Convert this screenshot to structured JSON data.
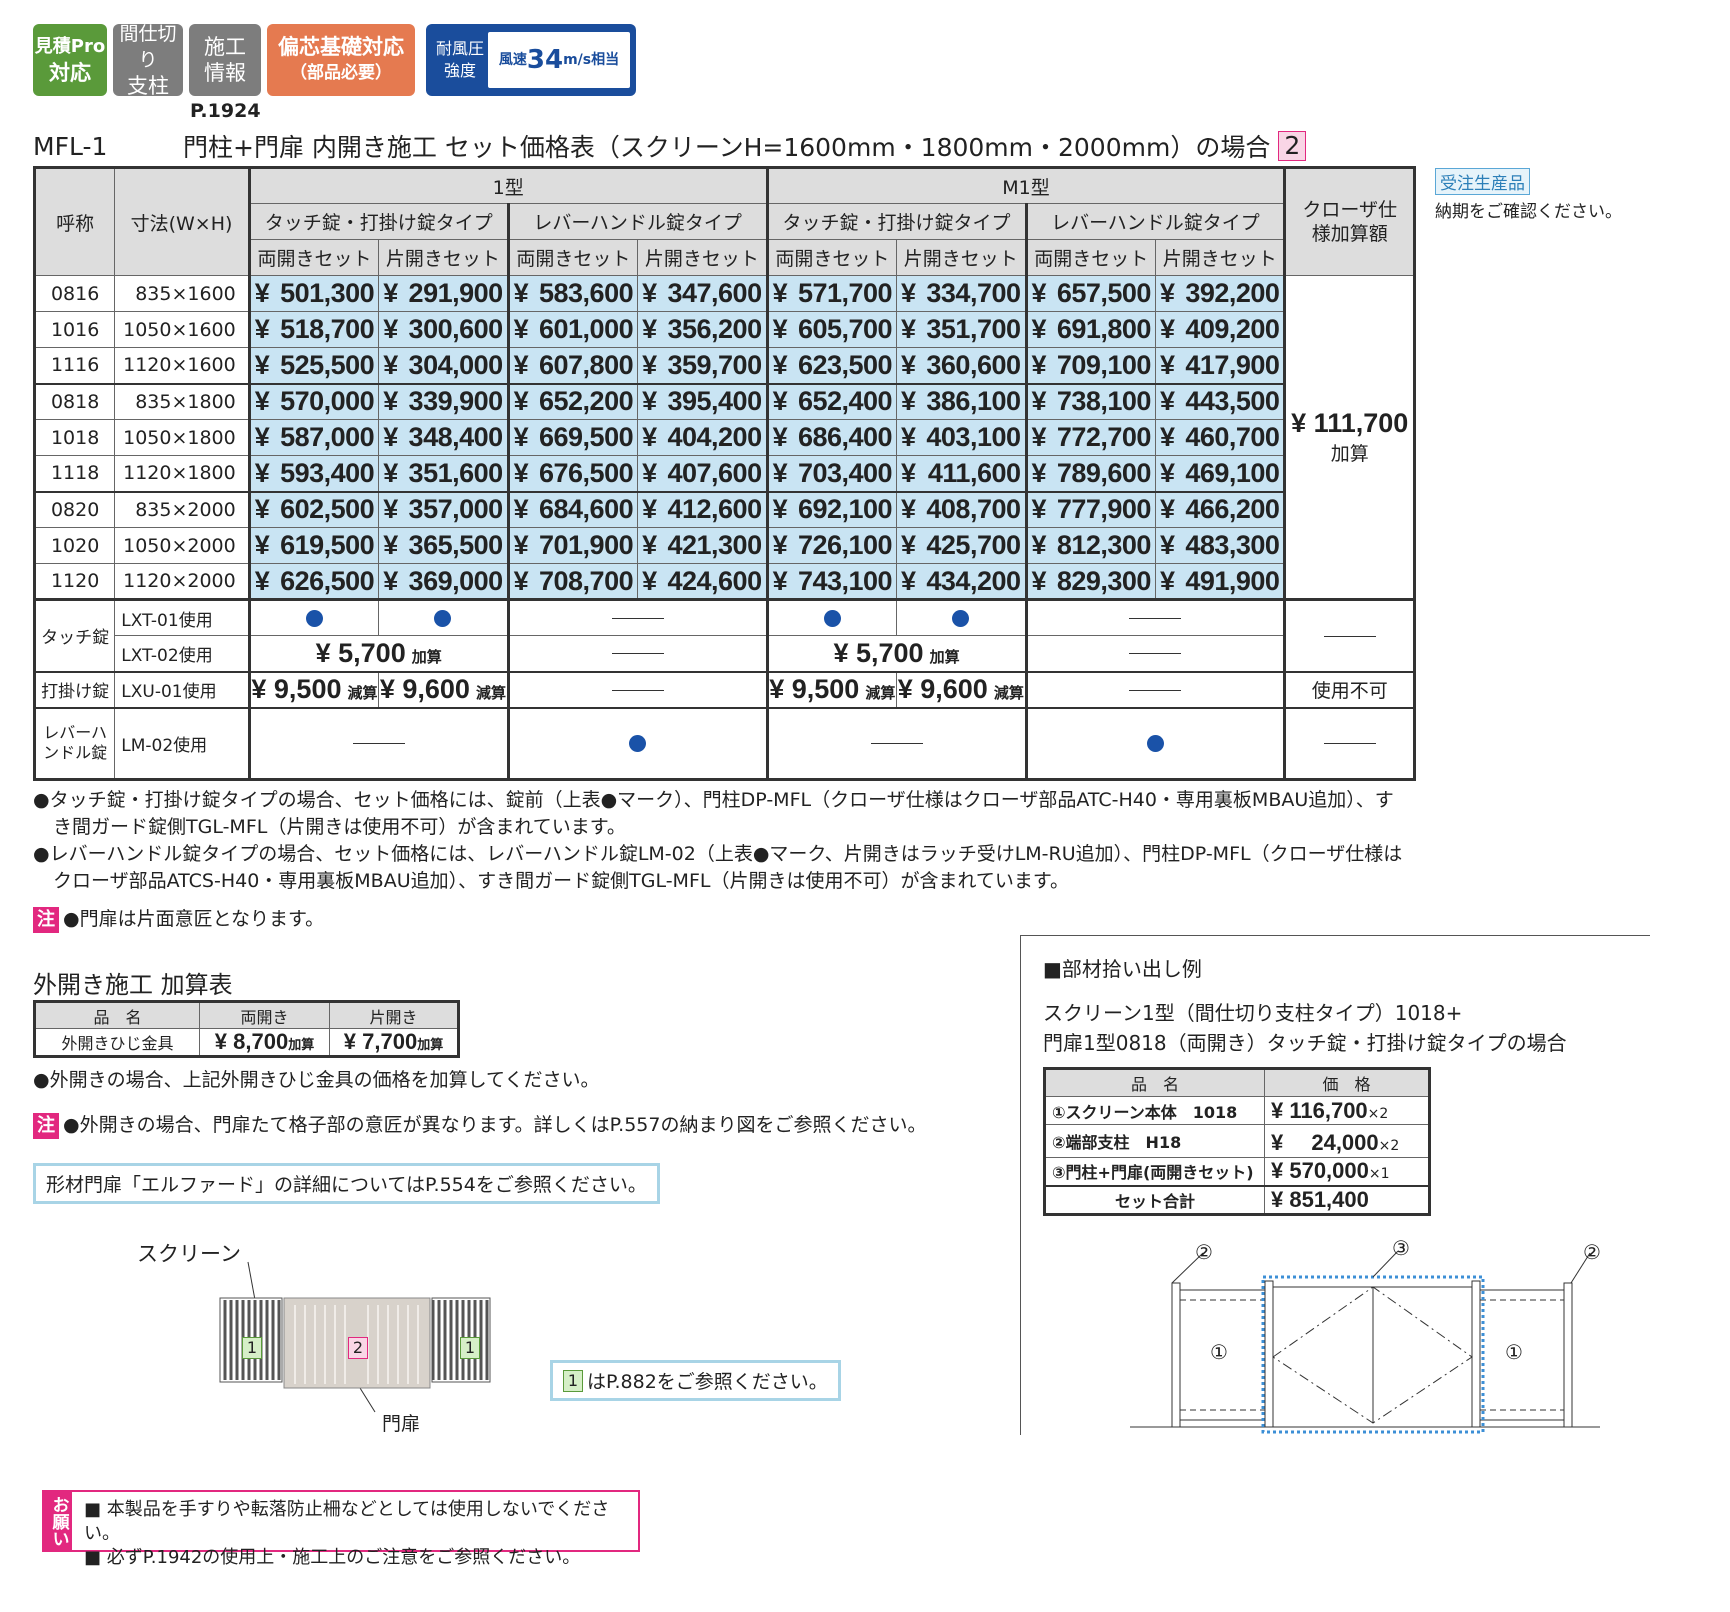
{
  "badges": {
    "mitsumori": [
      "見積Pro",
      "対応"
    ],
    "mashikiri": [
      "間仕切り",
      "支柱"
    ],
    "sekou": [
      "施工",
      "情報"
    ],
    "henshin": [
      "偏芯基礎対応",
      "（部品必要）"
    ],
    "wind_label": [
      "耐風圧",
      "強度"
    ],
    "wind_pre": "風速",
    "wind_num": "34",
    "wind_unit": "m/s相当"
  },
  "page_ref": "P.1924",
  "title": {
    "code": "MFL-1",
    "text": "門柱+門扉 内開き施工 セット価格表（スクリーンH=1600mm・1800mm・2000mm）の場合",
    "num": "2"
  },
  "side_note": {
    "badge": "受注生産品",
    "text": "納期をご確認ください。"
  },
  "main_table": {
    "h_name": "呼称",
    "h_size": "寸法(W×H)",
    "h_type1": "1型",
    "h_typem1": "M1型",
    "h_closer": "クローザ仕様加算額",
    "h_touch": "タッチ錠・打掛け錠タイプ",
    "h_lever": "レバーハンドル錠タイプ",
    "h_both": "両開きセット",
    "h_single": "片開きセット",
    "rows": [
      {
        "code": "0816",
        "size": "835×1600",
        "prices": [
          "501,300",
          "291,900",
          "583,600",
          "347,600",
          "571,700",
          "334,700",
          "657,500",
          "392,200"
        ]
      },
      {
        "code": "1016",
        "size": "1050×1600",
        "prices": [
          "518,700",
          "300,600",
          "601,000",
          "356,200",
          "605,700",
          "351,700",
          "691,800",
          "409,200"
        ]
      },
      {
        "code": "1116",
        "size": "1120×1600",
        "prices": [
          "525,500",
          "304,000",
          "607,800",
          "359,700",
          "623,500",
          "360,600",
          "709,100",
          "417,900"
        ]
      },
      {
        "code": "0818",
        "size": "835×1800",
        "prices": [
          "570,000",
          "339,900",
          "652,200",
          "395,400",
          "652,400",
          "386,100",
          "738,100",
          "443,500"
        ]
      },
      {
        "code": "1018",
        "size": "1050×1800",
        "prices": [
          "587,000",
          "348,400",
          "669,500",
          "404,200",
          "686,400",
          "403,100",
          "772,700",
          "460,700"
        ]
      },
      {
        "code": "1118",
        "size": "1120×1800",
        "prices": [
          "593,400",
          "351,600",
          "676,500",
          "407,600",
          "703,400",
          "411,600",
          "789,600",
          "469,100"
        ]
      },
      {
        "code": "0820",
        "size": "835×2000",
        "prices": [
          "602,500",
          "357,000",
          "684,600",
          "412,600",
          "692,100",
          "408,700",
          "777,900",
          "466,200"
        ]
      },
      {
        "code": "1020",
        "size": "1050×2000",
        "prices": [
          "619,500",
          "365,500",
          "701,900",
          "421,300",
          "726,100",
          "425,700",
          "812,300",
          "483,300"
        ]
      },
      {
        "code": "1120",
        "size": "1120×2000",
        "prices": [
          "626,500",
          "369,000",
          "708,700",
          "424,600",
          "743,100",
          "434,200",
          "829,300",
          "491,900"
        ]
      }
    ],
    "closer_price": "¥ 111,700",
    "closer_add": "加算",
    "yen": "¥",
    "opt": {
      "touch": "タッチ錠",
      "lxt01": "LXT-01使用",
      "lxt02": "LXT-02使用",
      "uchikake": "打掛け錠",
      "lxu01": "LXU-01使用",
      "lever": "レバーハンドル錠",
      "lm02": "LM-02使用",
      "add57": "¥ 5,700",
      "kasan": "加算",
      "sub95": "¥ 9,500",
      "sub96": "¥ 9,600",
      "gensan": "減算",
      "fuka": "使用不可"
    }
  },
  "notes": [
    "●タッチ錠・打掛け錠タイプの場合、セット価格には、錠前（上表●マーク）、門柱DP-MFL（クローザ仕様はクローザ部品ATC-H40・専用裏板MBAU追加）、す",
    "き間ガード錠側TGL-MFL（片開きは使用不可）が含まれています。",
    "●レバーハンドル錠タイプの場合、セット価格には、レバーハンドル錠LM-02（上表●マーク、片開きはラッチ受けLM-RU追加）、門柱DP-MFL（クローザ仕様は",
    "クローザ部品ATCS-H40・専用裏板MBAU追加）、すき間ガード錠側TGL-MFL（片開きは使用不可）が含まれています。"
  ],
  "chu_label": "注",
  "chu1": "●門扉は片面意匠となります。",
  "outer": {
    "title": "外開き施工 加算表",
    "h_name": "品　名",
    "h_both": "両開き",
    "h_single": "片開き",
    "item": "外開きひじ金具",
    "both_price": "¥ 8,700",
    "single_price": "¥ 7,700",
    "kasan": "加算",
    "note": "●外開きの場合、上記外開きひじ金具の価格を加算してください。",
    "chu": "●外開きの場合、門扉たて格子部の意匠が異なります。詳しくはP.557の納まり図をご参照ください。",
    "ref": "形材門扉「エルファード」の詳細についてはP.554をご参照ください。"
  },
  "diagram": {
    "screen": "スクリーン",
    "gate": "門扉",
    "n1": "1",
    "n2": "2",
    "ref": "はP.882をご参照ください。"
  },
  "parts": {
    "title": "■部材拾い出し例",
    "line1": "スクリーン1型（間仕切り支柱タイプ）1018+",
    "line2": "門扉1型0818（両開き）タッチ錠・打掛け錠タイプの場合",
    "h_name": "品　名",
    "h_price": "価　格",
    "rows": [
      {
        "name": "①スクリーン本体　1018",
        "price": "¥ 116,700",
        "qty": "×2"
      },
      {
        "name": "②端部支柱　H18",
        "price": "¥ 　24,000",
        "qty": "×2"
      },
      {
        "name": "③門柱+門扉(両開きセット)",
        "price": "¥ 570,000",
        "qty": "×1"
      }
    ],
    "total_label": "セット合計",
    "total": "¥ 851,400",
    "c1": "①",
    "c2": "②",
    "c3": "③"
  },
  "onegai": {
    "label": "お願い",
    "l1": "■ 本製品を手すりや転落防止柵などとしては使用しないでください。",
    "l2": "■ 必ずP.1942の使用上・施工上のご注意をご参照ください。"
  }
}
